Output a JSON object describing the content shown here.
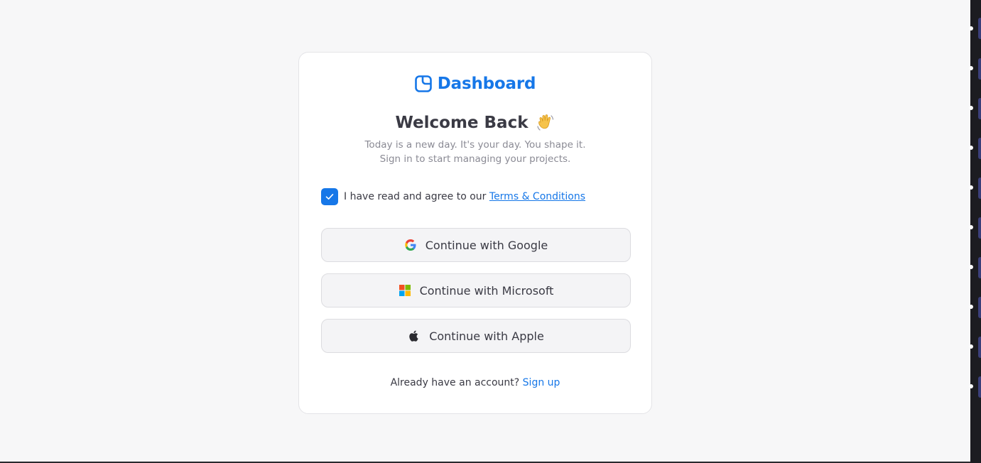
{
  "brand": {
    "name": "Dashboard",
    "logo_icon": "dashboard-logo-icon",
    "color": "#1677e8"
  },
  "header": {
    "title": "Welcome Back",
    "emoji_icon": "waving-hand-icon",
    "subtitle_line1": "Today is a new day. It's your day. You shape it.",
    "subtitle_line2": "Sign in to start managing your projects."
  },
  "terms": {
    "checked": true,
    "text": "I have read and agree to our",
    "link_label": "Terms & Conditions"
  },
  "auth_buttons": [
    {
      "label": "Continue with Google",
      "icon": "google-icon"
    },
    {
      "label": "Continue with Microsoft",
      "icon": "microsoft-icon"
    },
    {
      "label": "Continue with Apple",
      "icon": "apple-icon"
    }
  ],
  "footer": {
    "prompt": "Already have an account?",
    "link_label": "Sign up"
  },
  "colors": {
    "accent": "#1677e8",
    "background": "#f7f7f8",
    "card": "#ffffff",
    "text": "#3a3a44",
    "muted_text": "#8a8a94"
  }
}
